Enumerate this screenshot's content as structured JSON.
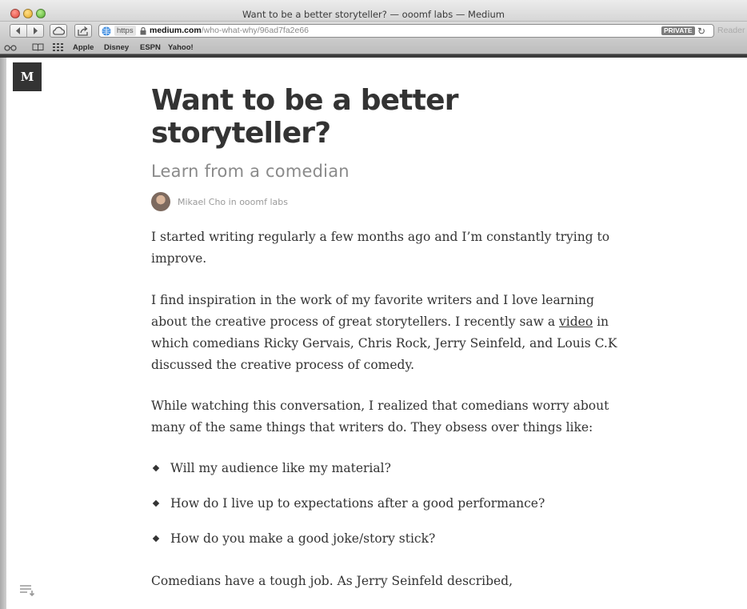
{
  "window": {
    "title": "Want to be a better storyteller? — ooomf labs — Medium"
  },
  "toolbar": {
    "url_scheme": "https",
    "url_host": "medium.com",
    "url_path": "/who-what-why/96ad7fa2e66",
    "private_label": "PRIVATE",
    "reader_label": "Reader"
  },
  "bookmarks": {
    "items": [
      "Apple",
      "Disney",
      "ESPN",
      "Yahoo!"
    ]
  },
  "site": {
    "logo_letter": "M"
  },
  "article": {
    "title": "Want to be a better storyteller?",
    "subtitle": "Learn from a comedian",
    "byline": "Mikael Cho in ooomf labs",
    "p1": "I started writing regularly a few months ago and I’m constantly trying to improve.",
    "p2_before": "I find inspiration in the work of my favorite writers and I love learning about the creative process of great storytellers. I recently saw a ",
    "p2_link": "video",
    "p2_after": " in which comedians Ricky Gervais, Chris Rock, Jerry Seinfeld, and Louis C.K discussed the creative process of comedy.",
    "p3": "While watching this conversation, I realized that comedians worry about many of the same things that writers do. They obsess over things like:",
    "bullets": [
      "Will my audience like my material?",
      "How do I live up to expectations after a good performance?",
      "How do you make a good joke/story stick?"
    ],
    "p4": "Comedians have a tough job. As Jerry Seinfeld described,"
  }
}
